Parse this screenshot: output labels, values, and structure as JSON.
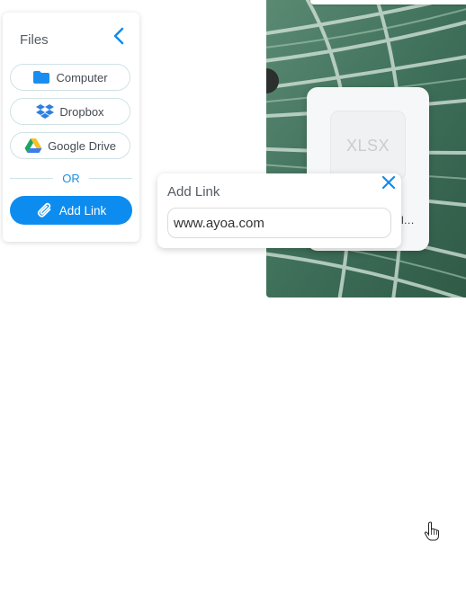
{
  "files_panel": {
    "title": "Files",
    "sources": [
      {
        "label": "Computer",
        "icon": "folder-icon"
      },
      {
        "label": "Dropbox",
        "icon": "dropbox-icon"
      },
      {
        "label": "Google Drive",
        "icon": "google-drive-icon"
      }
    ],
    "or_label": "OR",
    "add_link_label": "Add Link"
  },
  "add_link_popup": {
    "title": "Add Link",
    "input_value": "www.ayoa.com"
  },
  "file_card": {
    "type_label": "XLSX",
    "name_fragment": "l..."
  },
  "colors": {
    "accent": "#0d8cf0",
    "leaf_green": "#3d6b55"
  }
}
